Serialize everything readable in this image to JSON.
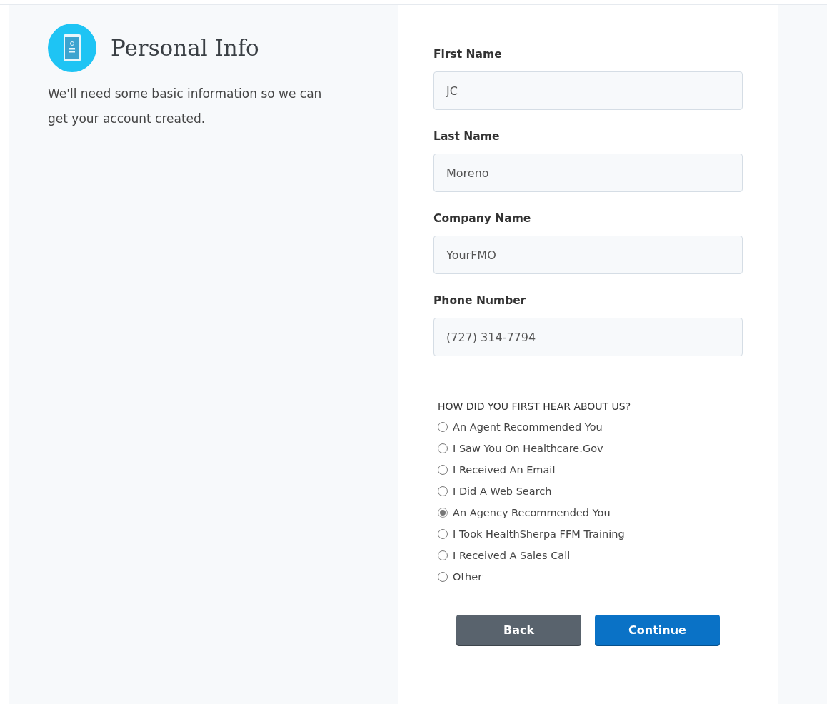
{
  "intro": {
    "title": "Personal Info",
    "description": "We'll need some basic information so we can get your account created."
  },
  "fields": [
    {
      "label": "First Name",
      "value": "JC"
    },
    {
      "label": "Last Name",
      "value": "Moreno"
    },
    {
      "label": "Company Name",
      "value": "YourFMO"
    },
    {
      "label": "Phone Number",
      "value": "(727) 314-7794"
    }
  ],
  "referral": {
    "question": "HOW DID YOU FIRST HEAR ABOUT US?",
    "options": [
      {
        "label": "An Agent Recommended You",
        "selected": false
      },
      {
        "label": "I Saw You On Healthcare.Gov",
        "selected": false
      },
      {
        "label": "I Received An Email",
        "selected": false
      },
      {
        "label": "I Did A Web Search",
        "selected": false
      },
      {
        "label": "An Agency Recommended You",
        "selected": true
      },
      {
        "label": "I Took HealthSherpa FFM Training",
        "selected": false
      },
      {
        "label": "I Received A Sales Call",
        "selected": false
      },
      {
        "label": "Other",
        "selected": false
      }
    ]
  },
  "buttons": [
    {
      "label": "Back",
      "kind": "secondary"
    },
    {
      "label": "Continue",
      "kind": "primary"
    }
  ]
}
